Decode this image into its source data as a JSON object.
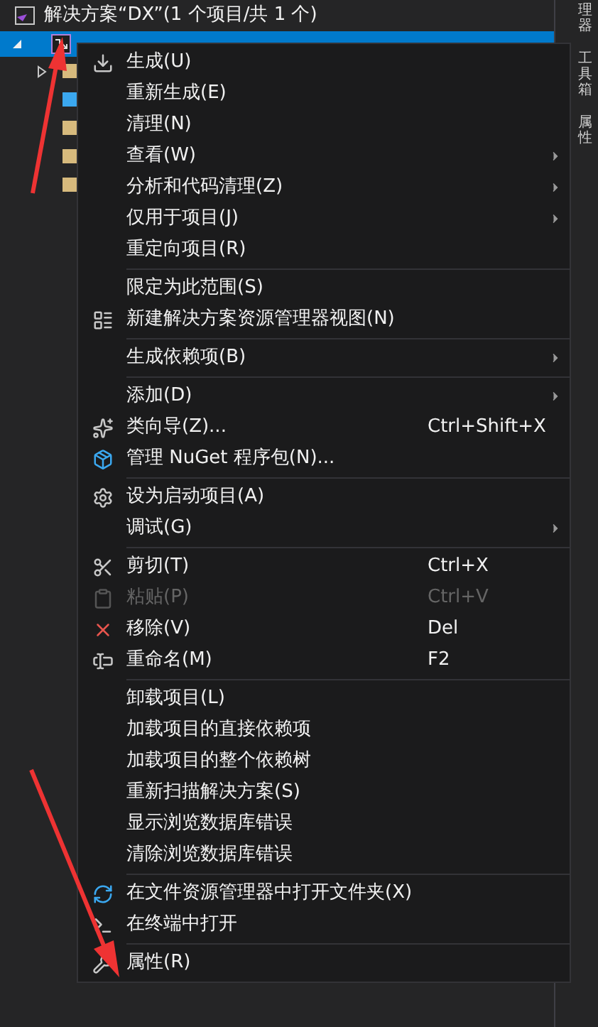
{
  "solution": {
    "title": "解决方案“DX”(1 个项目/共 1 个)"
  },
  "tree": {
    "selected_item": {
      "selected": true
    },
    "children": [
      {
        "kind": "folder",
        "expanded": false
      },
      {
        "kind": "file"
      },
      {
        "kind": "file"
      },
      {
        "kind": "file"
      },
      {
        "kind": "file"
      }
    ]
  },
  "side_tabs": [
    "理器",
    "工具箱",
    "属性"
  ],
  "menu": {
    "items": [
      {
        "kind": "item",
        "label": "生成(U)",
        "disabled": false,
        "submenu": false
      },
      {
        "kind": "item",
        "label": "重新生成(E)",
        "disabled": false,
        "submenu": false
      },
      {
        "kind": "item",
        "label": "清理(N)",
        "disabled": false,
        "submenu": false
      },
      {
        "kind": "item",
        "label": "查看(W)",
        "disabled": false,
        "submenu": true
      },
      {
        "kind": "item",
        "label": "分析和代码清理(Z)",
        "disabled": false,
        "submenu": true
      },
      {
        "kind": "item",
        "label": "仅用于项目(J)",
        "disabled": false,
        "submenu": true
      },
      {
        "kind": "item",
        "label": "重定向项目(R)",
        "disabled": false,
        "submenu": false
      },
      {
        "kind": "separator"
      },
      {
        "kind": "item",
        "label": "限定为此范围(S)",
        "disabled": false,
        "submenu": false
      },
      {
        "kind": "item",
        "label": "新建解决方案资源管理器视图(N)",
        "disabled": false,
        "submenu": false
      },
      {
        "kind": "separator"
      },
      {
        "kind": "item",
        "label": "生成依赖项(B)",
        "disabled": false,
        "submenu": true
      },
      {
        "kind": "separator"
      },
      {
        "kind": "item",
        "label": "添加(D)",
        "disabled": false,
        "submenu": true
      },
      {
        "kind": "item",
        "label": "类向导(Z)...",
        "shortcut": "Ctrl+Shift+X",
        "disabled": false,
        "submenu": false
      },
      {
        "kind": "item",
        "label": "管理 NuGet 程序包(N)...",
        "disabled": false,
        "submenu": false
      },
      {
        "kind": "separator"
      },
      {
        "kind": "item",
        "label": "设为启动项目(A)",
        "disabled": false,
        "submenu": false
      },
      {
        "kind": "item",
        "label": "调试(G)",
        "disabled": false,
        "submenu": true
      },
      {
        "kind": "separator"
      },
      {
        "kind": "item",
        "label": "剪切(T)",
        "shortcut": "Ctrl+X",
        "disabled": false,
        "submenu": false
      },
      {
        "kind": "item",
        "label": "粘贴(P)",
        "shortcut": "Ctrl+V",
        "disabled": true,
        "submenu": false
      },
      {
        "kind": "item",
        "label": "移除(V)",
        "shortcut": "Del",
        "disabled": false,
        "submenu": false
      },
      {
        "kind": "item",
        "label": "重命名(M)",
        "shortcut": "F2",
        "disabled": false,
        "submenu": false
      },
      {
        "kind": "separator"
      },
      {
        "kind": "item",
        "label": "卸载项目(L)",
        "disabled": false,
        "submenu": false
      },
      {
        "kind": "item",
        "label": "加载项目的直接依赖项",
        "disabled": false,
        "submenu": false
      },
      {
        "kind": "item",
        "label": "加载项目的整个依赖树",
        "disabled": false,
        "submenu": false
      },
      {
        "kind": "item",
        "label": "重新扫描解决方案(S)",
        "disabled": false,
        "submenu": false
      },
      {
        "kind": "item",
        "label": "显示浏览数据库错误",
        "disabled": false,
        "submenu": false
      },
      {
        "kind": "item",
        "label": "清除浏览数据库错误",
        "disabled": false,
        "submenu": false
      },
      {
        "kind": "separator"
      },
      {
        "kind": "item",
        "label": "在文件资源管理器中打开文件夹(X)",
        "disabled": false,
        "submenu": false
      },
      {
        "kind": "item",
        "label": "在终端中打开",
        "disabled": false,
        "submenu": false
      },
      {
        "kind": "separator"
      },
      {
        "kind": "item",
        "label": "属性(R)",
        "disabled": false,
        "submenu": false
      }
    ]
  }
}
